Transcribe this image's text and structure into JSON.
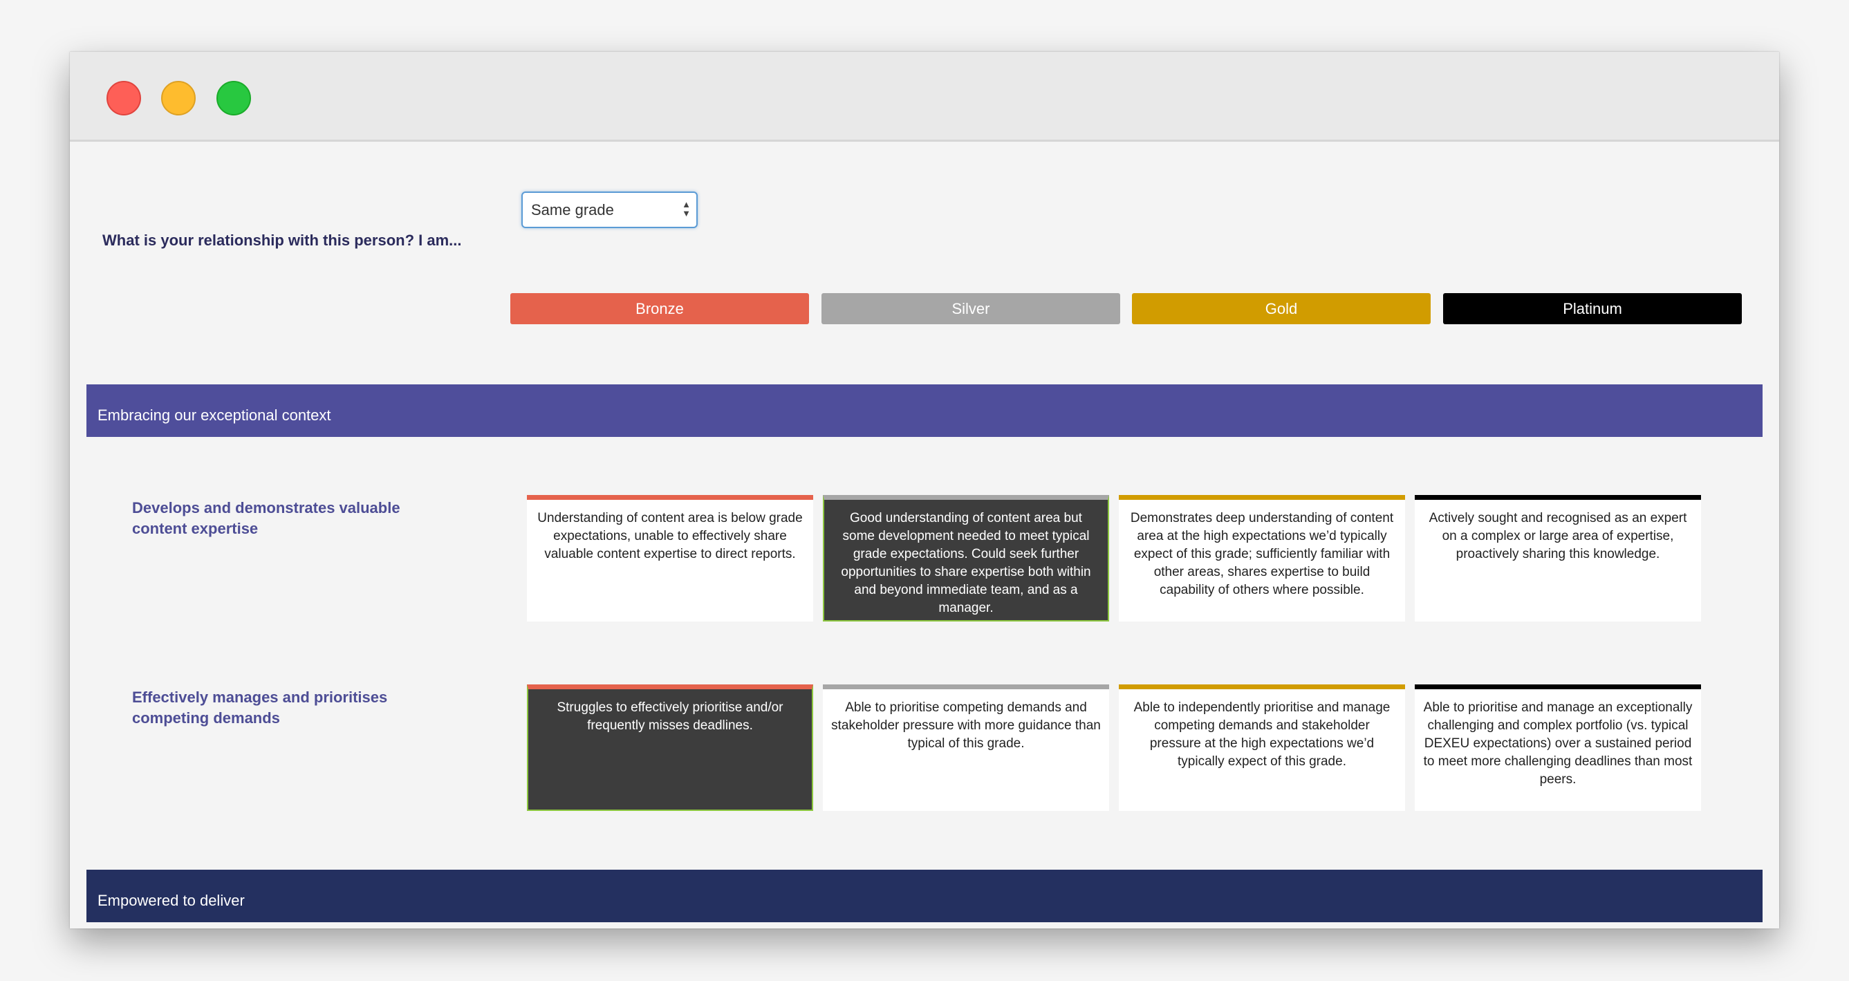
{
  "window": {
    "controls": [
      "close",
      "minimize",
      "zoom"
    ]
  },
  "question": {
    "label": "What is your relationship with this person? I am...",
    "selected_value": "Same grade",
    "arrows_icon": "up-down-arrows-icon"
  },
  "tiers": [
    {
      "label": "Bronze",
      "color": "#e5624c"
    },
    {
      "label": "Silver",
      "color": "#a6a6a6"
    },
    {
      "label": "Gold",
      "color": "#d19c00"
    },
    {
      "label": "Platinum",
      "color": "#000000"
    }
  ],
  "sections": [
    {
      "title": "Embracing our exceptional context",
      "color": "#4f4e9b",
      "behaviours": [
        {
          "label": "Develops and demonstrates valuable content expertise",
          "selected_index": 1,
          "levels": [
            "Understanding of content area is below grade expectations, unable to effectively share valuable content expertise to direct reports.",
            "Good understanding of content area but some development needed to meet typical grade expectations. Could seek further opportunities to share expertise both within and beyond immediate team, and as a manager.",
            "Demonstrates deep understanding of content area at the high expectations we’d typically expect of this grade; sufficiently familiar with other areas, shares expertise to build capability of others where possible.",
            "Actively sought and recognised as an expert on a complex or large area of expertise, proactively sharing this knowledge."
          ]
        },
        {
          "label": "Effectively manages and prioritises competing demands",
          "selected_index": 0,
          "levels": [
            "Struggles to effectively prioritise and/or frequently misses deadlines.",
            "Able to prioritise competing demands and stakeholder pressure with more guidance than typical of this grade.",
            "Able to independently prioritise and manage competing demands and stakeholder pressure at the high expectations we’d typically expect of this grade.",
            "Able to prioritise and manage an exceptionally challenging and complex portfolio (vs. typical DEXEU expectations) over a sustained period to meet more challenging deadlines than most peers."
          ]
        }
      ]
    },
    {
      "title": "Empowered to deliver",
      "color": "#243060"
    }
  ],
  "selection": {
    "highlight_color": "#8cc63f",
    "selected_card_color": "#3d3d3d"
  }
}
